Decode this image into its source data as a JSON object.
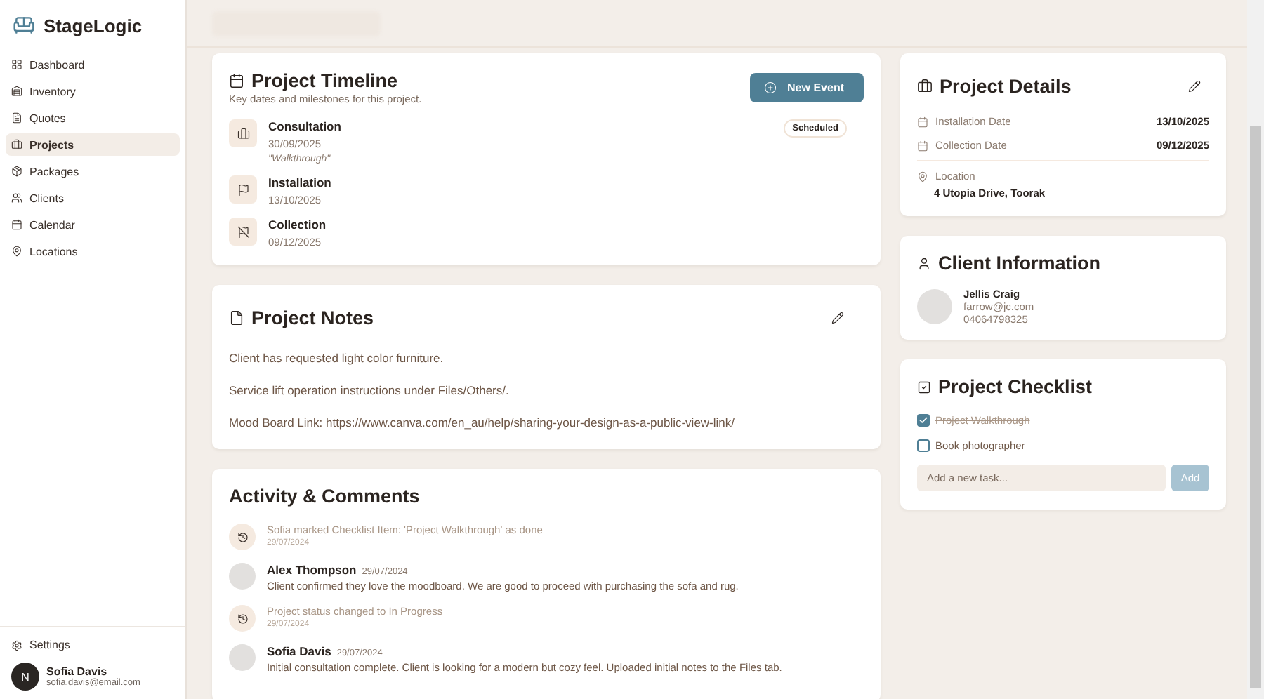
{
  "brand": "StageLogic",
  "sidebar": {
    "items": [
      {
        "label": "Dashboard",
        "selected": false
      },
      {
        "label": "Inventory",
        "selected": false
      },
      {
        "label": "Quotes",
        "selected": false
      },
      {
        "label": "Projects",
        "selected": true
      },
      {
        "label": "Packages",
        "selected": false
      },
      {
        "label": "Clients",
        "selected": false
      },
      {
        "label": "Calendar",
        "selected": false
      },
      {
        "label": "Locations",
        "selected": false
      }
    ],
    "settings": "Settings",
    "user": {
      "initial": "N",
      "name": "Sofia Davis",
      "email": "sofia.davis@email.com"
    }
  },
  "timeline": {
    "title": "Project Timeline",
    "subtitle": "Key dates and milestones for this project.",
    "button": "New Event",
    "events": [
      {
        "kind": "consultation",
        "title": "Consultation",
        "date": "30/09/2025",
        "note": "\"Walkthrough\"",
        "badge": "Scheduled"
      },
      {
        "kind": "installation",
        "title": "Installation",
        "date": "13/10/2025"
      },
      {
        "kind": "collection",
        "title": "Collection",
        "date": "09/12/2025"
      }
    ]
  },
  "notes": {
    "title": "Project Notes",
    "lines": [
      "Client has requested light color furniture.",
      "Service lift operation instructions under Files/Others/.",
      "Mood Board Link: https://www.canva.com/en_au/help/sharing-your-design-as-a-public-view-link/"
    ]
  },
  "activity": {
    "title": "Activity & Comments",
    "items": [
      {
        "kind": "event",
        "text": "Sofia marked Checklist Item: 'Project Walkthrough' as done",
        "date": "29/07/2024"
      },
      {
        "kind": "comment",
        "author": "Alex Thompson",
        "date": "29/07/2024",
        "text": "Client confirmed they love the moodboard. We are good to proceed with purchasing the sofa and rug."
      },
      {
        "kind": "event",
        "text": "Project status changed to In Progress",
        "date": "29/07/2024"
      },
      {
        "kind": "comment",
        "author": "Sofia Davis",
        "date": "29/07/2024",
        "text": "Initial consultation complete. Client is looking for a modern but cozy feel. Uploaded initial notes to the Files tab."
      }
    ]
  },
  "details": {
    "title": "Project Details",
    "dates": [
      {
        "label": "Installation Date",
        "value": "13/10/2025"
      },
      {
        "label": "Collection Date",
        "value": "09/12/2025"
      }
    ],
    "location_label": "Location",
    "location": "4 Utopia Drive, Toorak"
  },
  "client": {
    "title": "Client Information",
    "name": "Jellis Craig",
    "email": "farrow@jc.com",
    "phone": "04064798325"
  },
  "checklist": {
    "title": "Project Checklist",
    "items": [
      {
        "label": "Project Walkthrough",
        "checked": true
      },
      {
        "label": "Book photographer",
        "checked": false
      }
    ],
    "placeholder": "Add a new task...",
    "button": "Add"
  }
}
